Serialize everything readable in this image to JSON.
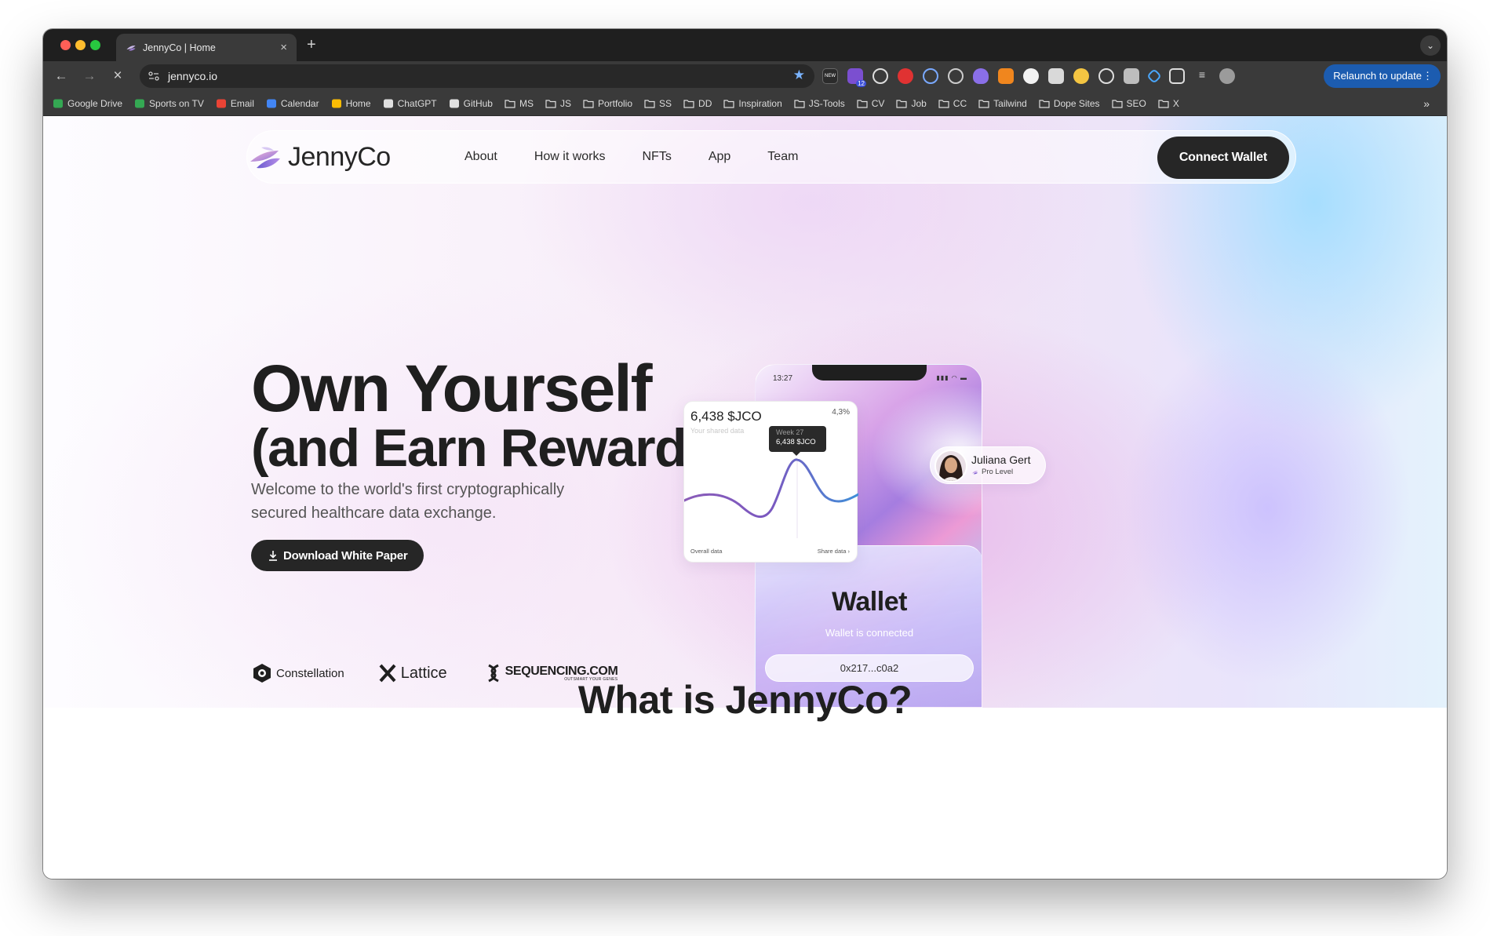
{
  "browser": {
    "tab_title": "JennyCo | Home",
    "url": "jennyco.io",
    "relaunch_label": "Relaunch to update",
    "bookmarks": [
      {
        "label": "Google Drive",
        "icon": "google-drive-icon"
      },
      {
        "label": "Sports on TV",
        "icon": "tv-icon"
      },
      {
        "label": "Email",
        "icon": "gmail-icon"
      },
      {
        "label": "Calendar",
        "icon": "calendar-icon"
      },
      {
        "label": "Home",
        "icon": "map-pin-icon"
      },
      {
        "label": "ChatGPT",
        "icon": "chatgpt-icon"
      },
      {
        "label": "GitHub",
        "icon": "github-icon"
      },
      {
        "label": "MS",
        "icon": "folder-icon"
      },
      {
        "label": "JS",
        "icon": "folder-icon"
      },
      {
        "label": "Portfolio",
        "icon": "folder-icon"
      },
      {
        "label": "SS",
        "icon": "folder-icon"
      },
      {
        "label": "DD",
        "icon": "folder-icon"
      },
      {
        "label": "Inspiration",
        "icon": "folder-icon"
      },
      {
        "label": "JS-Tools",
        "icon": "folder-icon"
      },
      {
        "label": "CV",
        "icon": "folder-icon"
      },
      {
        "label": "Job",
        "icon": "folder-icon"
      },
      {
        "label": "CC",
        "icon": "folder-icon"
      },
      {
        "label": "Tailwind",
        "icon": "folder-icon"
      },
      {
        "label": "Dope Sites",
        "icon": "folder-icon"
      },
      {
        "label": "SEO",
        "icon": "folder-icon"
      },
      {
        "label": "X",
        "icon": "folder-icon"
      }
    ],
    "extension_badge": "12"
  },
  "site": {
    "logo": "JennyCo",
    "nav": [
      "About",
      "How it works",
      "NFTs",
      "App",
      "Team"
    ],
    "connect_label": "Connect Wallet"
  },
  "hero": {
    "title_line1": "Own Yourself",
    "title_line2": "(and Earn Rewards)",
    "subtitle": "Welcome to the world's first cryptographically secured healthcare data exchange.",
    "download_label": "Download White Paper",
    "partners": {
      "constellation": "Constellation",
      "lattice": "Lattice",
      "sequencing": "SEQUENCING.COM",
      "sequencing_tag": "OUTSMART YOUR GENES"
    }
  },
  "phone": {
    "time": "13:27",
    "wallet_title": "Wallet",
    "wallet_status": "Wallet is connected",
    "wallet_address": "0x217...c0a2"
  },
  "data_card": {
    "value": "6,438 $JCO",
    "sub": "Your shared data",
    "percent": "4,3%",
    "tooltip_week": "Week 27",
    "tooltip_value": "6,438 $JCO",
    "footer_left": "Overall data",
    "footer_right": "Share data"
  },
  "profile": {
    "name": "Juliana Gert",
    "level": "Pro Level"
  },
  "section": {
    "title": "What is JennyCo?"
  },
  "colors": {
    "dark_button": "#262626",
    "relaunch_blue": "#1c5cb0",
    "chart_line_start": "#8a5cb8",
    "chart_line_end": "#3f8fd8"
  }
}
